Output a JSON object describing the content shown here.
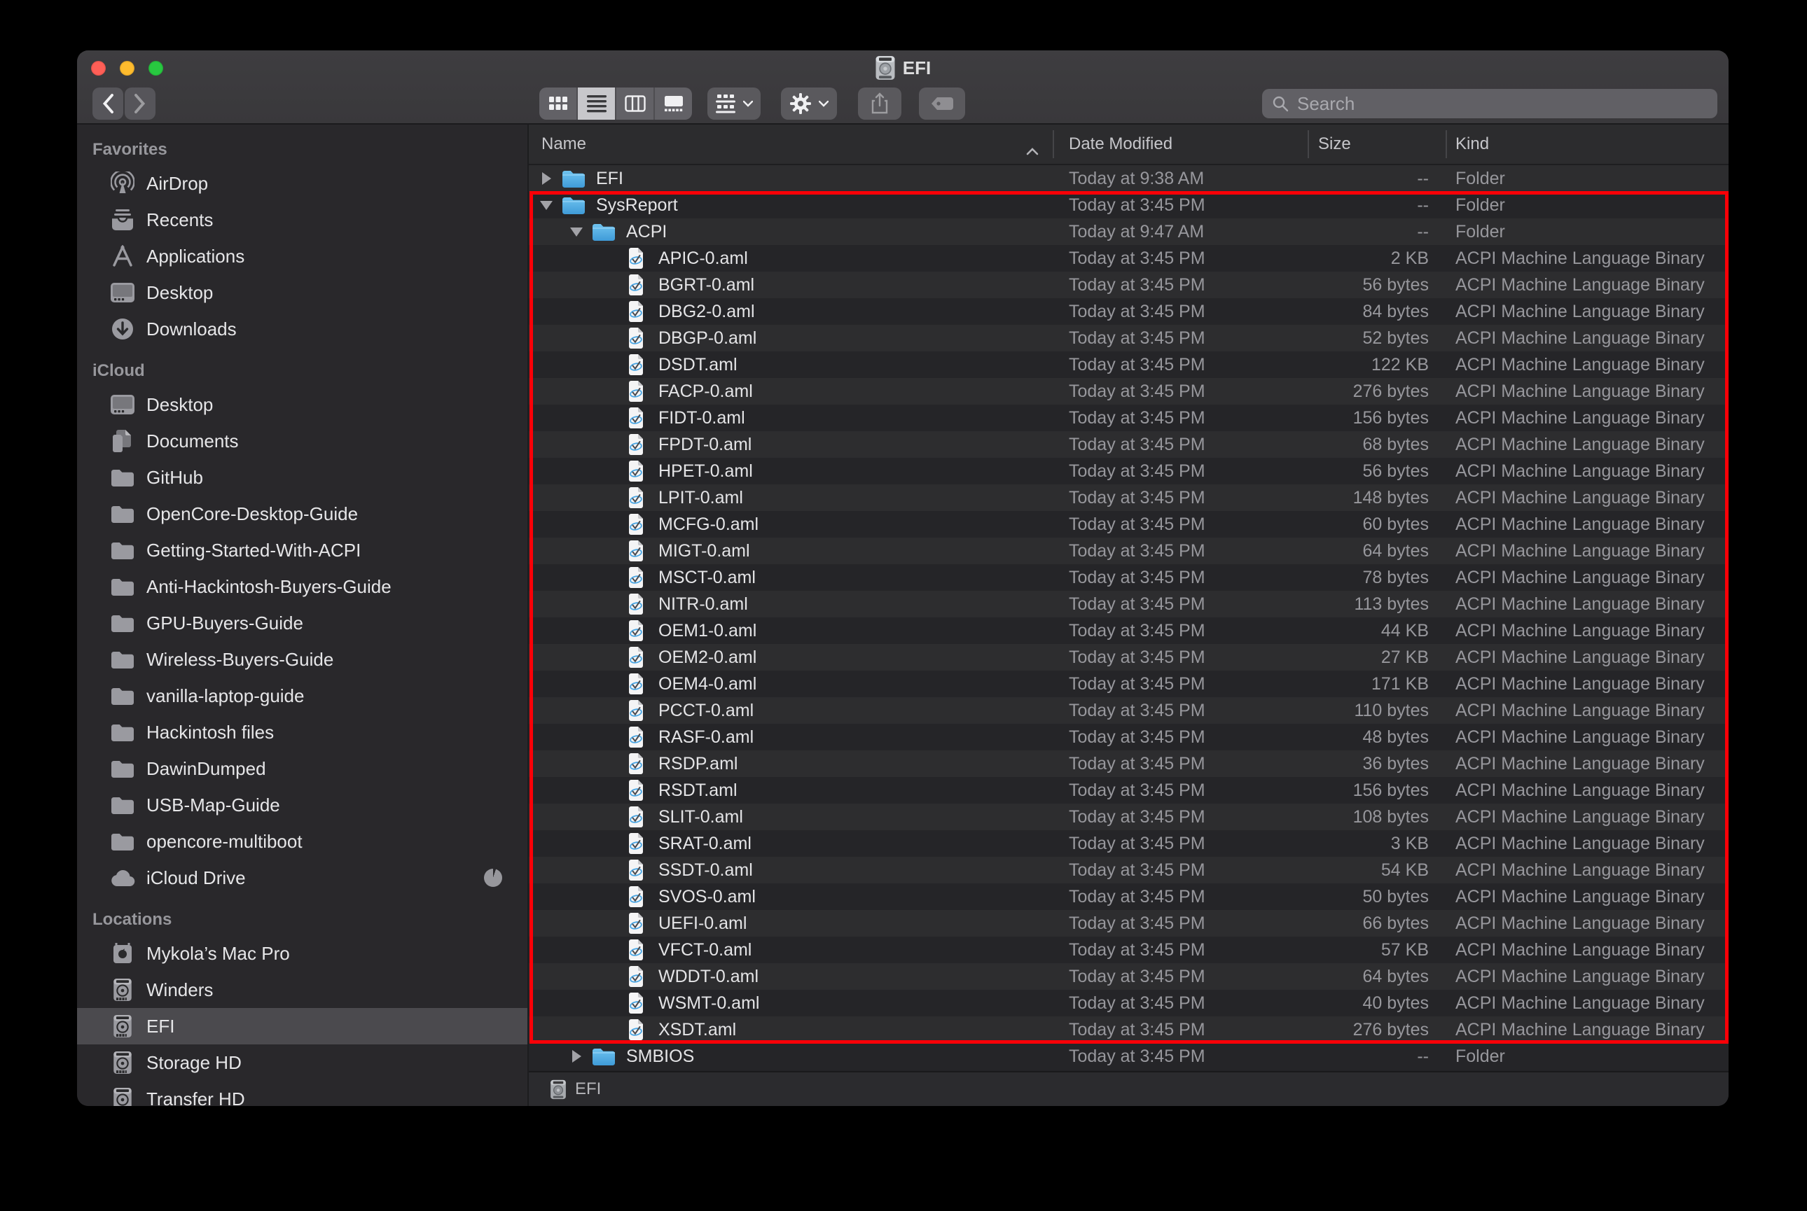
{
  "window": {
    "title": "EFI",
    "traffic_lights": {
      "close": "#ff5f57",
      "minimize": "#febc2e",
      "zoom": "#28c840"
    }
  },
  "toolbar": {
    "search_placeholder": "Search",
    "view_modes": [
      "icons",
      "list",
      "columns",
      "gallery"
    ],
    "selected_view": "list",
    "buttons": [
      "back",
      "forward",
      "group",
      "action",
      "share",
      "tag"
    ]
  },
  "sidebar": {
    "sections": [
      {
        "label": "Favorites",
        "items": [
          {
            "icon": "airdrop-icon",
            "label": "AirDrop"
          },
          {
            "icon": "recents-icon",
            "label": "Recents"
          },
          {
            "icon": "applications-icon",
            "label": "Applications"
          },
          {
            "icon": "desktop-icon",
            "label": "Desktop"
          },
          {
            "icon": "downloads-icon",
            "label": "Downloads"
          }
        ]
      },
      {
        "label": "iCloud",
        "items": [
          {
            "icon": "desktop-icon",
            "label": "Desktop"
          },
          {
            "icon": "documents-icon",
            "label": "Documents"
          },
          {
            "icon": "folder-icon",
            "label": "GitHub"
          },
          {
            "icon": "folder-icon",
            "label": "OpenCore-Desktop-Guide"
          },
          {
            "icon": "folder-icon",
            "label": "Getting-Started-With-ACPI"
          },
          {
            "icon": "folder-icon",
            "label": "Anti-Hackintosh-Buyers-Guide"
          },
          {
            "icon": "folder-icon",
            "label": "GPU-Buyers-Guide"
          },
          {
            "icon": "folder-icon",
            "label": "Wireless-Buyers-Guide"
          },
          {
            "icon": "folder-icon",
            "label": "vanilla-laptop-guide"
          },
          {
            "icon": "folder-icon",
            "label": "Hackintosh files"
          },
          {
            "icon": "folder-icon",
            "label": "DawinDumped"
          },
          {
            "icon": "folder-icon",
            "label": "USB-Map-Guide"
          },
          {
            "icon": "folder-icon",
            "label": "opencore-multiboot"
          },
          {
            "icon": "cloud-icon",
            "label": "iCloud Drive",
            "badge": "sync-progress"
          }
        ]
      },
      {
        "label": "Locations",
        "items": [
          {
            "icon": "macpro-icon",
            "label": "Mykola’s Mac Pro"
          },
          {
            "icon": "disk-icon",
            "label": "Winders"
          },
          {
            "icon": "disk-icon",
            "label": "EFI",
            "selected": true
          },
          {
            "icon": "disk-icon",
            "label": "Storage HD"
          },
          {
            "icon": "disk-icon",
            "label": "Transfer HD"
          }
        ]
      }
    ]
  },
  "list": {
    "columns": [
      "Name",
      "Date Modified",
      "Size",
      "Kind"
    ],
    "sort": {
      "column": "Name",
      "direction": "ascending"
    },
    "rows": [
      {
        "name": "EFI",
        "level": 0,
        "type": "folder",
        "disclosure": "collapsed",
        "date": "Today at 9:38 AM",
        "size": "--",
        "kind": "Folder"
      },
      {
        "name": "SysReport",
        "level": 0,
        "type": "folder",
        "disclosure": "expanded",
        "date": "Today at 3:45 PM",
        "size": "--",
        "kind": "Folder"
      },
      {
        "name": "ACPI",
        "level": 1,
        "type": "folder",
        "disclosure": "expanded",
        "date": "Today at 9:47 AM",
        "size": "--",
        "kind": "Folder"
      },
      {
        "name": "APIC-0.aml",
        "level": 2,
        "type": "file",
        "date": "Today at 3:45 PM",
        "size": "2 KB",
        "kind": "ACPI Machine Language Binary"
      },
      {
        "name": "BGRT-0.aml",
        "level": 2,
        "type": "file",
        "date": "Today at 3:45 PM",
        "size": "56 bytes",
        "kind": "ACPI Machine Language Binary"
      },
      {
        "name": "DBG2-0.aml",
        "level": 2,
        "type": "file",
        "date": "Today at 3:45 PM",
        "size": "84 bytes",
        "kind": "ACPI Machine Language Binary"
      },
      {
        "name": "DBGP-0.aml",
        "level": 2,
        "type": "file",
        "date": "Today at 3:45 PM",
        "size": "52 bytes",
        "kind": "ACPI Machine Language Binary"
      },
      {
        "name": "DSDT.aml",
        "level": 2,
        "type": "file",
        "date": "Today at 3:45 PM",
        "size": "122 KB",
        "kind": "ACPI Machine Language Binary"
      },
      {
        "name": "FACP-0.aml",
        "level": 2,
        "type": "file",
        "date": "Today at 3:45 PM",
        "size": "276 bytes",
        "kind": "ACPI Machine Language Binary"
      },
      {
        "name": "FIDT-0.aml",
        "level": 2,
        "type": "file",
        "date": "Today at 3:45 PM",
        "size": "156 bytes",
        "kind": "ACPI Machine Language Binary"
      },
      {
        "name": "FPDT-0.aml",
        "level": 2,
        "type": "file",
        "date": "Today at 3:45 PM",
        "size": "68 bytes",
        "kind": "ACPI Machine Language Binary"
      },
      {
        "name": "HPET-0.aml",
        "level": 2,
        "type": "file",
        "date": "Today at 3:45 PM",
        "size": "56 bytes",
        "kind": "ACPI Machine Language Binary"
      },
      {
        "name": "LPIT-0.aml",
        "level": 2,
        "type": "file",
        "date": "Today at 3:45 PM",
        "size": "148 bytes",
        "kind": "ACPI Machine Language Binary"
      },
      {
        "name": "MCFG-0.aml",
        "level": 2,
        "type": "file",
        "date": "Today at 3:45 PM",
        "size": "60 bytes",
        "kind": "ACPI Machine Language Binary"
      },
      {
        "name": "MIGT-0.aml",
        "level": 2,
        "type": "file",
        "date": "Today at 3:45 PM",
        "size": "64 bytes",
        "kind": "ACPI Machine Language Binary"
      },
      {
        "name": "MSCT-0.aml",
        "level": 2,
        "type": "file",
        "date": "Today at 3:45 PM",
        "size": "78 bytes",
        "kind": "ACPI Machine Language Binary"
      },
      {
        "name": "NITR-0.aml",
        "level": 2,
        "type": "file",
        "date": "Today at 3:45 PM",
        "size": "113 bytes",
        "kind": "ACPI Machine Language Binary"
      },
      {
        "name": "OEM1-0.aml",
        "level": 2,
        "type": "file",
        "date": "Today at 3:45 PM",
        "size": "44 KB",
        "kind": "ACPI Machine Language Binary"
      },
      {
        "name": "OEM2-0.aml",
        "level": 2,
        "type": "file",
        "date": "Today at 3:45 PM",
        "size": "27 KB",
        "kind": "ACPI Machine Language Binary"
      },
      {
        "name": "OEM4-0.aml",
        "level": 2,
        "type": "file",
        "date": "Today at 3:45 PM",
        "size": "171 KB",
        "kind": "ACPI Machine Language Binary"
      },
      {
        "name": "PCCT-0.aml",
        "level": 2,
        "type": "file",
        "date": "Today at 3:45 PM",
        "size": "110 bytes",
        "kind": "ACPI Machine Language Binary"
      },
      {
        "name": "RASF-0.aml",
        "level": 2,
        "type": "file",
        "date": "Today at 3:45 PM",
        "size": "48 bytes",
        "kind": "ACPI Machine Language Binary"
      },
      {
        "name": "RSDP.aml",
        "level": 2,
        "type": "file",
        "date": "Today at 3:45 PM",
        "size": "36 bytes",
        "kind": "ACPI Machine Language Binary"
      },
      {
        "name": "RSDT.aml",
        "level": 2,
        "type": "file",
        "date": "Today at 3:45 PM",
        "size": "156 bytes",
        "kind": "ACPI Machine Language Binary"
      },
      {
        "name": "SLIT-0.aml",
        "level": 2,
        "type": "file",
        "date": "Today at 3:45 PM",
        "size": "108 bytes",
        "kind": "ACPI Machine Language Binary"
      },
      {
        "name": "SRAT-0.aml",
        "level": 2,
        "type": "file",
        "date": "Today at 3:45 PM",
        "size": "3 KB",
        "kind": "ACPI Machine Language Binary"
      },
      {
        "name": "SSDT-0.aml",
        "level": 2,
        "type": "file",
        "date": "Today at 3:45 PM",
        "size": "54 KB",
        "kind": "ACPI Machine Language Binary"
      },
      {
        "name": "SVOS-0.aml",
        "level": 2,
        "type": "file",
        "date": "Today at 3:45 PM",
        "size": "50 bytes",
        "kind": "ACPI Machine Language Binary"
      },
      {
        "name": "UEFI-0.aml",
        "level": 2,
        "type": "file",
        "date": "Today at 3:45 PM",
        "size": "66 bytes",
        "kind": "ACPI Machine Language Binary"
      },
      {
        "name": "VFCT-0.aml",
        "level": 2,
        "type": "file",
        "date": "Today at 3:45 PM",
        "size": "57 KB",
        "kind": "ACPI Machine Language Binary"
      },
      {
        "name": "WDDT-0.aml",
        "level": 2,
        "type": "file",
        "date": "Today at 3:45 PM",
        "size": "64 bytes",
        "kind": "ACPI Machine Language Binary"
      },
      {
        "name": "WSMT-0.aml",
        "level": 2,
        "type": "file",
        "date": "Today at 3:45 PM",
        "size": "40 bytes",
        "kind": "ACPI Machine Language Binary"
      },
      {
        "name": "XSDT.aml",
        "level": 2,
        "type": "file",
        "date": "Today at 3:45 PM",
        "size": "276 bytes",
        "kind": "ACPI Machine Language Binary"
      },
      {
        "name": "SMBIOS",
        "level": 1,
        "type": "folder",
        "disclosure": "collapsed",
        "date": "Today at 3:45 PM",
        "size": "--",
        "kind": "Folder"
      }
    ]
  },
  "footer": {
    "path_item": "EFI"
  },
  "annotation": {
    "highlight_color": "#fb0007",
    "highlighted_range": "SysReport through XSDT.aml"
  }
}
